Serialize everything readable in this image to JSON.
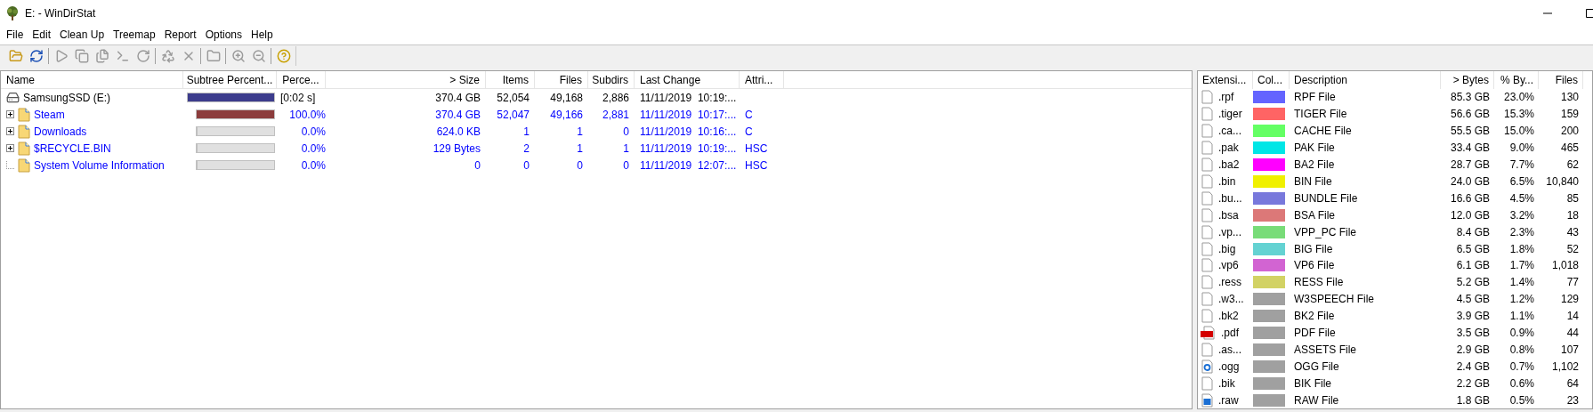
{
  "window": {
    "title": "E: - WinDirStat"
  },
  "menu": [
    "File",
    "Edit",
    "Clean Up",
    "Treemap",
    "Report",
    "Options",
    "Help"
  ],
  "toolbar": [
    [
      {
        "kind": "open",
        "disabled": false
      },
      {
        "kind": "refresh",
        "disabled": false
      }
    ],
    [
      {
        "kind": "play",
        "disabled": true
      },
      {
        "kind": "copy",
        "disabled": true
      },
      {
        "kind": "explorer",
        "disabled": true
      },
      {
        "kind": "console",
        "disabled": true
      },
      {
        "kind": "refresh",
        "disabled": true
      }
    ],
    [
      {
        "kind": "recycle",
        "disabled": true
      },
      {
        "kind": "delete",
        "disabled": true
      }
    ],
    [
      {
        "kind": "folder",
        "disabled": true
      }
    ],
    [
      {
        "kind": "zoom-in",
        "disabled": true
      },
      {
        "kind": "zoom-out",
        "disabled": true
      }
    ],
    [
      {
        "kind": "help",
        "disabled": false
      }
    ]
  ],
  "tree": {
    "columns": [
      "Name",
      "Subtree Percent...",
      "Perce...",
      "> Size",
      "Items",
      "Files",
      "Subdirs",
      "Last Change",
      "Attri..."
    ],
    "rows": [
      {
        "kind": "drive",
        "name": "SamsungSSD (E:)",
        "level": 1,
        "color": "#3c3c8c",
        "percent": "[0:02 s]",
        "size": "370.4 GB",
        "items": "52,054",
        "files": "49,168",
        "subdirs": "2,886",
        "last_change": "11/11/2019  10:19:...",
        "attributes": "",
        "children": [
          {
            "kind": "folder",
            "name": "Steam",
            "expandable": true,
            "level": 1,
            "color": "#8c3c3c",
            "percent": "100.0%",
            "size": "370.4 GB",
            "items": "52,047",
            "files": "49,166",
            "subdirs": "2,881",
            "last_change": "11/11/2019  10:17:...",
            "attributes": "C"
          },
          {
            "kind": "folder",
            "name": "Downloads",
            "expandable": true,
            "level": 0,
            "percent": "0.0%",
            "size": "624.0 KB",
            "items": "1",
            "files": "1",
            "subdirs": "0",
            "last_change": "11/11/2019  10:16:...",
            "attributes": "C"
          },
          {
            "kind": "folder",
            "name": "$RECYCLE.BIN",
            "expandable": true,
            "level": 0,
            "percent": "0.0%",
            "size": "129 Bytes",
            "items": "2",
            "files": "1",
            "subdirs": "1",
            "last_change": "11/11/2019  10:19:...",
            "attributes": "HSC"
          },
          {
            "kind": "folder",
            "name": "System Volume Information",
            "expandable": false,
            "level": 0,
            "percent": "0.0%",
            "size": "0",
            "items": "0",
            "files": "0",
            "subdirs": "0",
            "last_change": "11/11/2019  12:07:...",
            "attributes": "HSC"
          }
        ]
      }
    ]
  },
  "extensions": {
    "columns": [
      "Extensi...",
      "Col...",
      "Description",
      "> Bytes",
      "% By...",
      "Files"
    ],
    "rows": [
      {
        "kind": "file",
        "extension": ".rpf",
        "color": "#6464ff",
        "description": "RPF File",
        "bytes": "85.3 GB",
        "percent": "23.0%",
        "files": "130"
      },
      {
        "kind": "file",
        "extension": ".tiger",
        "color": "#ff6464",
        "description": "TIGER File",
        "bytes": "56.6 GB",
        "percent": "15.3%",
        "files": "159"
      },
      {
        "kind": "file",
        "extension": ".ca...",
        "color": "#64ff64",
        "description": "CACHE File",
        "bytes": "55.5 GB",
        "percent": "15.0%",
        "files": "200"
      },
      {
        "kind": "file",
        "extension": ".pak",
        "color": "#00e6e6",
        "description": "PAK File",
        "bytes": "33.4 GB",
        "percent": "9.0%",
        "files": "465"
      },
      {
        "kind": "file",
        "extension": ".ba2",
        "color": "#ff00ff",
        "description": "BA2 File",
        "bytes": "28.7 GB",
        "percent": "7.7%",
        "files": "62"
      },
      {
        "kind": "file",
        "extension": ".bin",
        "color": "#f0f000",
        "description": "BIN File",
        "bytes": "24.0 GB",
        "percent": "6.5%",
        "files": "10,840"
      },
      {
        "kind": "file",
        "extension": ".bu...",
        "color": "#7878dc",
        "description": "BUNDLE File",
        "bytes": "16.6 GB",
        "percent": "4.5%",
        "files": "85"
      },
      {
        "kind": "file",
        "extension": ".bsa",
        "color": "#dc7878",
        "description": "BSA File",
        "bytes": "12.0 GB",
        "percent": "3.2%",
        "files": "18"
      },
      {
        "kind": "file",
        "extension": ".vp...",
        "color": "#78dc78",
        "description": "VPP_PC File",
        "bytes": "8.4 GB",
        "percent": "2.3%",
        "files": "43"
      },
      {
        "kind": "file",
        "extension": ".big",
        "color": "#64d2d2",
        "description": "BIG File",
        "bytes": "6.5 GB",
        "percent": "1.8%",
        "files": "52"
      },
      {
        "kind": "file",
        "extension": ".vp6",
        "color": "#d264d2",
        "description": "VP6 File",
        "bytes": "6.1 GB",
        "percent": "1.7%",
        "files": "1,018"
      },
      {
        "kind": "file",
        "extension": ".ress",
        "color": "#d2d264",
        "description": "RESS File",
        "bytes": "5.2 GB",
        "percent": "1.4%",
        "files": "77"
      },
      {
        "kind": "file",
        "extension": ".w3...",
        "color": "#a0a0a0",
        "description": "W3SPEECH File",
        "bytes": "4.5 GB",
        "percent": "1.2%",
        "files": "129"
      },
      {
        "kind": "file",
        "extension": ".bk2",
        "color": "#a0a0a0",
        "description": "BK2 File",
        "bytes": "3.9 GB",
        "percent": "1.1%",
        "files": "14"
      },
      {
        "kind": "pdf",
        "extension": ".pdf",
        "color": "#a0a0a0",
        "description": "PDF File",
        "bytes": "3.5 GB",
        "percent": "0.9%",
        "files": "44"
      },
      {
        "kind": "file",
        "extension": ".as...",
        "color": "#a0a0a0",
        "description": "ASSETS File",
        "bytes": "2.9 GB",
        "percent": "0.8%",
        "files": "107"
      },
      {
        "kind": "audio",
        "extension": ".ogg",
        "color": "#a0a0a0",
        "description": "OGG File",
        "bytes": "2.4 GB",
        "percent": "0.7%",
        "files": "1,102"
      },
      {
        "kind": "file",
        "extension": ".bik",
        "color": "#a0a0a0",
        "description": "BIK File",
        "bytes": "2.2 GB",
        "percent": "0.6%",
        "files": "64"
      },
      {
        "kind": "image",
        "extension": ".raw",
        "color": "#a0a0a0",
        "description": "RAW File",
        "bytes": "1.8 GB",
        "percent": "0.5%",
        "files": "23"
      }
    ]
  }
}
